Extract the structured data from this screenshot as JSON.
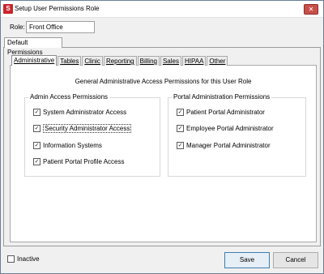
{
  "window": {
    "title": "Setup User Permissions Role",
    "close_glyph": "✕",
    "app_icon_glyph": "S"
  },
  "role": {
    "label": "Role:",
    "value": "Front Office"
  },
  "outer_tab": {
    "label": "Default Permissions"
  },
  "inner_tabs": [
    {
      "label": "Administrative",
      "active": true
    },
    {
      "label": "Tables"
    },
    {
      "label": "Clinic"
    },
    {
      "label": "Reporting"
    },
    {
      "label": "Billing"
    },
    {
      "label": "Sales"
    },
    {
      "label": "HIPAA"
    },
    {
      "label": "Other"
    }
  ],
  "panel": {
    "heading": "General Administrative Access Permissions for this User Role",
    "admin_group": {
      "title": "Admin Access Permissions",
      "items": [
        {
          "label": "System Administrator Access",
          "checked": true
        },
        {
          "label": "Security Administrator Access",
          "checked": true
        },
        {
          "label": "Information Systems",
          "checked": true
        },
        {
          "label": "Patient Portal Profile Access",
          "checked": true
        }
      ]
    },
    "portal_group": {
      "title": "Portal Administration Permissions",
      "items": [
        {
          "label": "Patient Portal Administrator",
          "checked": true
        },
        {
          "label": "Employee Portal Administrator",
          "checked": true
        },
        {
          "label": "Manager Portal Administrator",
          "checked": true
        }
      ]
    }
  },
  "footer": {
    "inactive_label": "Inactive",
    "inactive_checked": false,
    "save_label": "Save",
    "cancel_label": "Cancel"
  },
  "check_glyph": "✓",
  "colors": {
    "close_button": "#c7504b",
    "app_icon": "#c8262b",
    "default_button_border": "#3c7fb1"
  }
}
